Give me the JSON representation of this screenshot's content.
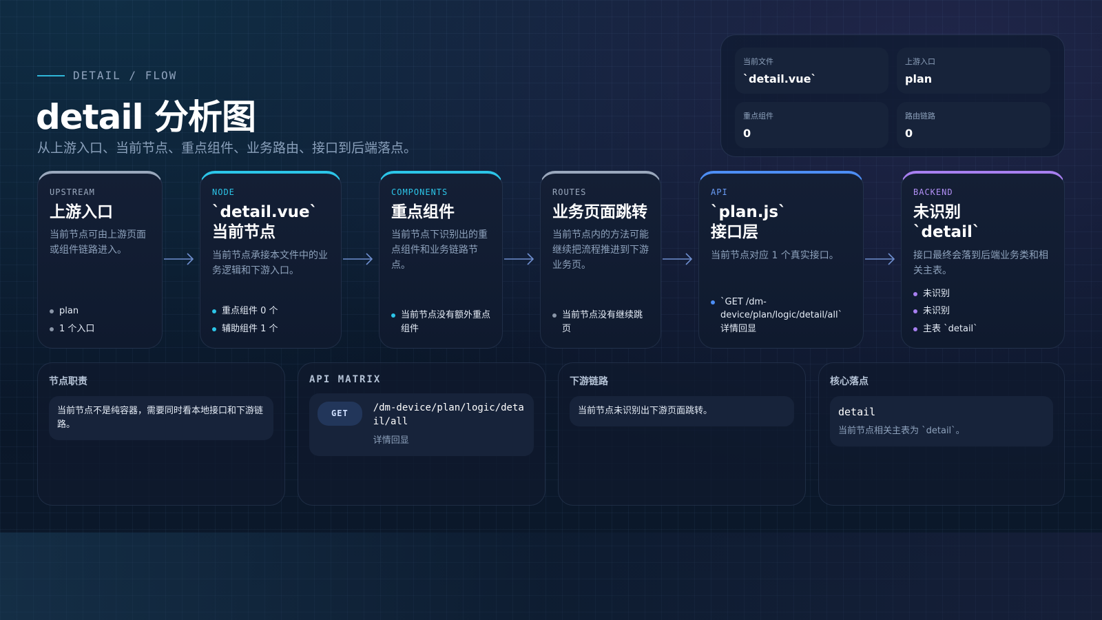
{
  "header": {
    "kicker": "DETAIL / FLOW",
    "title": "detail 分析图",
    "subtitle": "从上游入口、当前节点、重点组件、业务路由、接口到后端落点。"
  },
  "stats": [
    {
      "label": "当前文件",
      "value": "`detail.vue`"
    },
    {
      "label": "上游入口",
      "value": "plan"
    },
    {
      "label": "重点组件",
      "value": "0"
    },
    {
      "label": "路由链路",
      "value": "0"
    }
  ],
  "flow": {
    "upstream": {
      "tag": "UPSTREAM",
      "title": "上游入口",
      "desc": "当前节点可由上游页面或组件链路进入。",
      "items": [
        "plan",
        "1 个入口"
      ]
    },
    "node": {
      "tag": "NODE",
      "title_line1": "`detail.vue`",
      "title_line2": "当前节点",
      "desc": "当前节点承接本文件中的业务逻辑和下游入口。",
      "items": [
        "重点组件 0 个",
        "辅助组件 1 个"
      ]
    },
    "components": {
      "tag": "COMPONENTS",
      "title": "重点组件",
      "desc": "当前节点下识别出的重点组件和业务链路节点。",
      "items": [
        "当前节点没有额外重点组件"
      ]
    },
    "routes": {
      "tag": "ROUTES",
      "title": "业务页面跳转",
      "desc": "当前节点内的方法可能继续把流程推进到下游业务页。",
      "items": [
        "当前节点没有继续跳页"
      ]
    },
    "api": {
      "tag": "API",
      "title_line1": "`plan.js`",
      "title_line2": "接口层",
      "desc": "当前节点对应 1 个真实接口。",
      "items": [
        "`GET /dm-device/plan/logic/detail/all` 详情回显"
      ]
    },
    "backend": {
      "tag": "BACKEND",
      "title_line1": "未识别",
      "title_line2": "`detail`",
      "desc": "接口最终会落到后端业务类和相关主表。",
      "items": [
        "未识别",
        "未识别",
        "主表 `detail`"
      ]
    }
  },
  "panels": {
    "duty": {
      "title": "节点职责",
      "text": "当前节点不是纯容器，需要同时看本地接口和下游链路。"
    },
    "api_matrix": {
      "title": "API MATRIX",
      "method": "GET",
      "path": "/dm-device/plan/logic/detail/all",
      "note": "详情回显"
    },
    "downstream": {
      "title": "下游链路",
      "text": "当前节点未识别出下游页面跳转。"
    },
    "core": {
      "title": "核心落点",
      "value": "detail",
      "note": "当前节点相关主表为 `detail`。"
    }
  },
  "colors": {
    "accent_cyan": "#2cc5e8",
    "accent_blue": "#4d8ef5",
    "accent_purple": "#a77ff0",
    "neutral": "#9aa8bd",
    "background": "#0a1628"
  }
}
